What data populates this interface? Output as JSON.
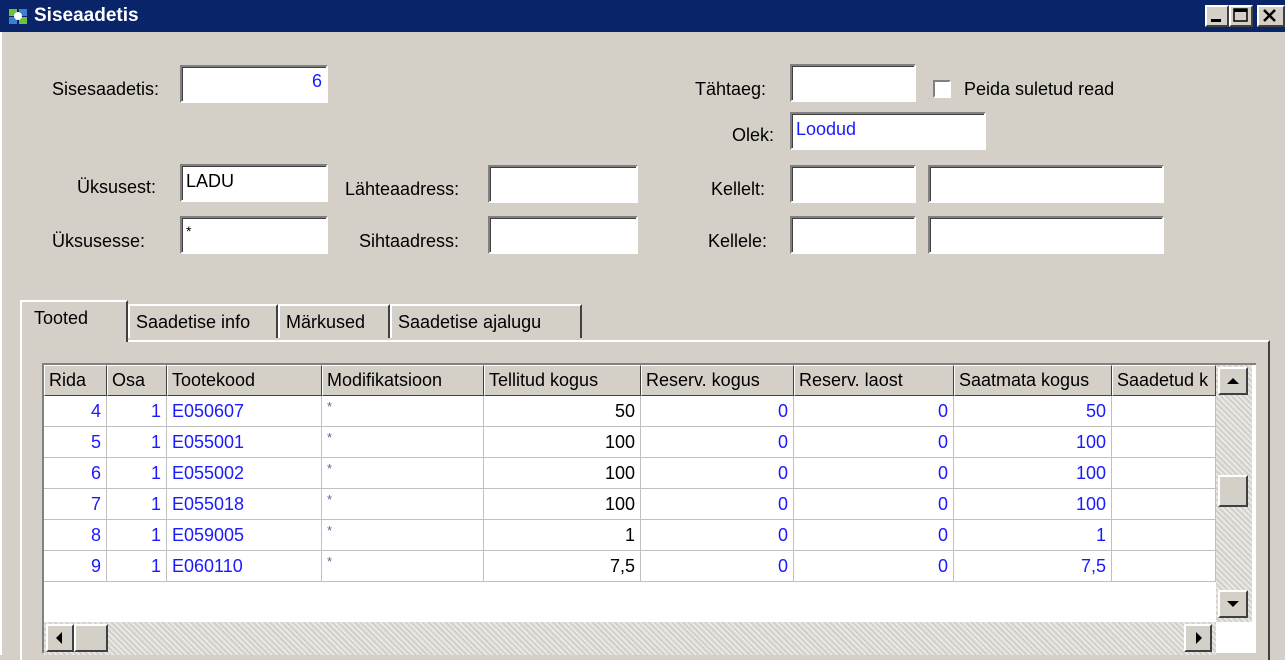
{
  "window": {
    "title": "Siseaadetis"
  },
  "form": {
    "sisesaadetis_label": "Sisesaadetis:",
    "sisesaadetis_value": "6",
    "tahtaeg_label": "Tähtaeg:",
    "tahtaeg_value": "",
    "peida_label": "Peida suletud read",
    "olek_label": "Olek:",
    "olek_value": "Loodud",
    "uksusest_label": "Üksusest:",
    "uksusest_value": "LADU",
    "lahteaadress_label": "Lähteaadress:",
    "lahteaadress_value": "",
    "kellelt_label": "Kellelt:",
    "kellelt_value1": "",
    "kellelt_value2": "",
    "uksusesse_label": "Üksusesse:",
    "uksusesse_value": "*",
    "sihtaadress_label": "Sihtaadress:",
    "sihtaadress_value": "",
    "kellele_label": "Kellele:",
    "kellele_value1": "",
    "kellele_value2": ""
  },
  "tabs": [
    "Tooted",
    "Saadetise info",
    "Märkused",
    "Saadetise ajalugu"
  ],
  "grid": {
    "columns": [
      "Rida",
      "Osa",
      "Tootekood",
      "Modifikatsioon",
      "Tellitud kogus",
      "Reserv. kogus",
      "Reserv. laost",
      "Saatmata kogus",
      "Saadetud k"
    ],
    "rows": [
      [
        "4",
        "1",
        "E050607",
        "*",
        "50",
        "0",
        "0",
        "50",
        ""
      ],
      [
        "5",
        "1",
        "E055001",
        "*",
        "100",
        "0",
        "0",
        "100",
        ""
      ],
      [
        "6",
        "1",
        "E055002",
        "*",
        "100",
        "0",
        "0",
        "100",
        ""
      ],
      [
        "7",
        "1",
        "E055018",
        "*",
        "100",
        "0",
        "0",
        "100",
        ""
      ],
      [
        "8",
        "1",
        "E059005",
        "*",
        "1",
        "0",
        "0",
        "1",
        ""
      ],
      [
        "9",
        "1",
        "E060110",
        "*",
        "7,5",
        "0",
        "0",
        "7,5",
        ""
      ]
    ]
  },
  "colors": {
    "titlebar": "#0a246a",
    "value_text": "#1a1aff",
    "face": "#d4d0c8"
  }
}
